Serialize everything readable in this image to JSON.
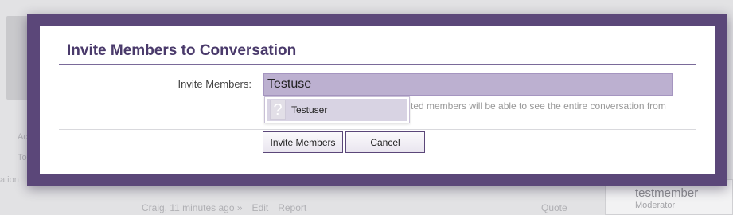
{
  "background": {
    "member_name": "testmember",
    "member_role": "Moderator",
    "post_meta": "Craig, 11 minutes ago »",
    "edit_link": "Edit",
    "report_link": "Report",
    "quote_link": "Quote",
    "fragment_1": "Ac",
    "fragment_2": "To",
    "fragment_3": "ation"
  },
  "dialog": {
    "title": "Invite Members to Conversation",
    "field_label": "Invite Members:",
    "input_value": "Testuse",
    "hint": "ted members will be able to see the entire conversation from",
    "suggestion": {
      "avatar_glyph": "?",
      "name": "Testuser"
    },
    "buttons": {
      "invite": "Invite Members",
      "cancel": "Cancel"
    }
  },
  "colors": {
    "frame": "#5b4779",
    "title": "#4a3a6b",
    "input_bg": "#bcb0d0",
    "suggestion_bg": "#d8d3e3"
  }
}
